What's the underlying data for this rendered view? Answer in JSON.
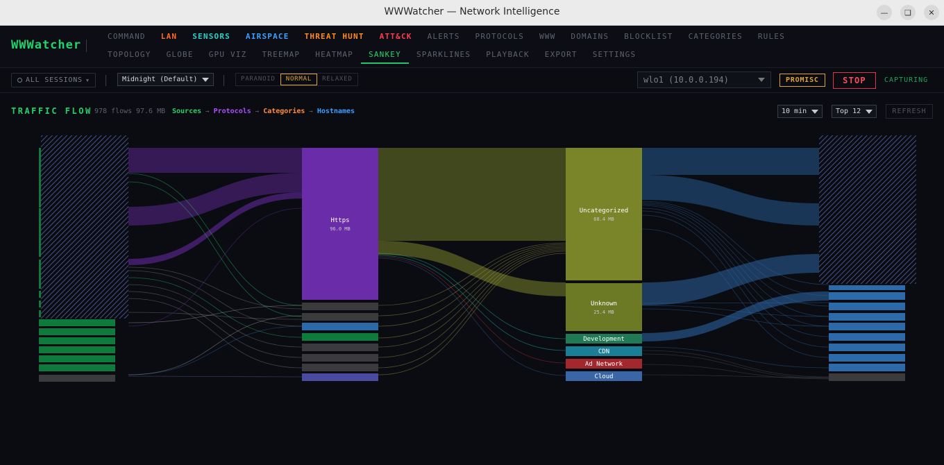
{
  "window": {
    "title": "WWWatcher — Network Intelligence",
    "min_icon": "minimize-icon",
    "max_icon": "maximize-icon",
    "close_icon": "close-icon"
  },
  "brand": "WWWatcher",
  "nav": {
    "row1": [
      {
        "label": "COMMAND",
        "color": "#5d6270"
      },
      {
        "label": "LAN",
        "color": "#ff6a2b"
      },
      {
        "label": "SENSORS",
        "color": "#22d3c6"
      },
      {
        "label": "AIRSPACE",
        "color": "#3aa0ff"
      },
      {
        "label": "THREAT HUNT",
        "color": "#ff8c1a"
      },
      {
        "label": "ATT&CK",
        "color": "#ff3b4f"
      },
      {
        "label": "ALERTS",
        "color": "#5d6270"
      },
      {
        "label": "PROTOCOLS",
        "color": "#5d6270"
      },
      {
        "label": "WWW",
        "color": "#5d6270"
      },
      {
        "label": "DOMAINS",
        "color": "#5d6270"
      },
      {
        "label": "BLOCKLIST",
        "color": "#5d6270"
      },
      {
        "label": "CATEGORIES",
        "color": "#5d6270"
      },
      {
        "label": "RULES",
        "color": "#5d6270"
      }
    ],
    "row2": [
      {
        "label": "TOPOLOGY",
        "active": false
      },
      {
        "label": "GLOBE",
        "active": false
      },
      {
        "label": "GPU VIZ",
        "active": false
      },
      {
        "label": "TREEMAP",
        "active": false
      },
      {
        "label": "HEATMAP",
        "active": false
      },
      {
        "label": "SANKEY",
        "active": true
      },
      {
        "label": "SPARKLINES",
        "active": false
      },
      {
        "label": "PLAYBACK",
        "active": false
      },
      {
        "label": "EXPORT",
        "active": false
      },
      {
        "label": "SETTINGS",
        "active": false
      }
    ]
  },
  "toolbar": {
    "sessions_label": "ALL SESSIONS",
    "theme": "Midnight (Default)",
    "modes": [
      {
        "label": "PARANOID",
        "active": false
      },
      {
        "label": "NORMAL",
        "active": true
      },
      {
        "label": "RELAXED",
        "active": false
      }
    ],
    "interface": "wlo1 (10.0.0.194)",
    "promisc_label": "PROMISC",
    "stop_label": "STOP",
    "status": "CAPTURING"
  },
  "traffic_flow": {
    "title": "TRAFFIC FLOW",
    "flows": "978 flows",
    "size": "97.6 MB",
    "crumbs": [
      {
        "label": "Sources",
        "color": "#22d36b"
      },
      {
        "label": "Protocols",
        "color": "#b04cff"
      },
      {
        "label": "Categories",
        "color": "#ff8c3a"
      },
      {
        "label": "Hostnames",
        "color": "#3aa0ff"
      }
    ],
    "window_select": "10 min",
    "top_select": "Top 12",
    "refresh_label": "REFRESH"
  },
  "sankey": {
    "protocols": [
      {
        "label": "Https",
        "value": "96.0 MB"
      }
    ],
    "categories": [
      {
        "label": "Uncategorized",
        "value": "68.4 MB"
      },
      {
        "label": "Unknown",
        "value": "25.4 MB"
      },
      {
        "label": "Development"
      },
      {
        "label": "CDN"
      },
      {
        "label": "Ad Network"
      },
      {
        "label": "Cloud"
      }
    ],
    "colors": {
      "source": "#0e7a3c",
      "other": "#3b3b3e",
      "https": "#6a2ca8",
      "uncategorized": "#7a8428",
      "development": "#1f7a55",
      "cdn": "#1a7f96",
      "ad_network": "#a4272d",
      "cloud": "#3a66a8",
      "host": "#2d6aaa",
      "hatch": "#5563a8"
    }
  }
}
